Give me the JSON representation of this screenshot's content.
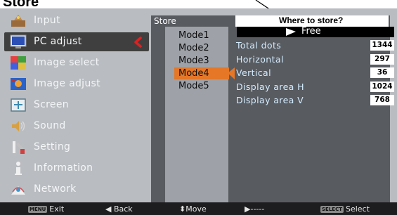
{
  "callout_title": "Store",
  "menu": {
    "items": [
      {
        "label": "Input",
        "icon": "input-icon"
      },
      {
        "label": "PC adjust",
        "icon": "pc-adjust-icon",
        "active": true
      },
      {
        "label": "Image select",
        "icon": "image-select-icon"
      },
      {
        "label": "Image adjust",
        "icon": "image-adjust-icon"
      },
      {
        "label": "Screen",
        "icon": "screen-icon"
      },
      {
        "label": "Sound",
        "icon": "sound-icon"
      },
      {
        "label": "Setting",
        "icon": "setting-icon"
      },
      {
        "label": "Information",
        "icon": "information-icon"
      },
      {
        "label": "Network",
        "icon": "network-icon"
      }
    ]
  },
  "submenu": {
    "header": "Store",
    "prompt": "Where to store?",
    "slot_status": "Free",
    "modes": [
      "Mode1",
      "Mode2",
      "Mode3",
      "Mode4",
      "Mode5"
    ],
    "selected_mode": "Mode4",
    "rows": [
      {
        "label": "Total dots",
        "value": "1344"
      },
      {
        "label": "Horizontal",
        "value": "297"
      },
      {
        "label": "Vertical",
        "value": "36"
      },
      {
        "label": "Display area H",
        "value": "1024"
      },
      {
        "label": "Display area V",
        "value": "768"
      }
    ]
  },
  "bottom_bar": {
    "exit_key": "MENU",
    "exit": "Exit",
    "back": "Back",
    "move": "Move",
    "next": "-----",
    "select_key": "SELECT",
    "select": "Select"
  },
  "colors": {
    "highlight": "#e57727",
    "active_arrow": "#e02020",
    "menu_bg": "#b9bcc0",
    "submenu_bg": "#585b60",
    "value_text": "#d4ecff"
  }
}
